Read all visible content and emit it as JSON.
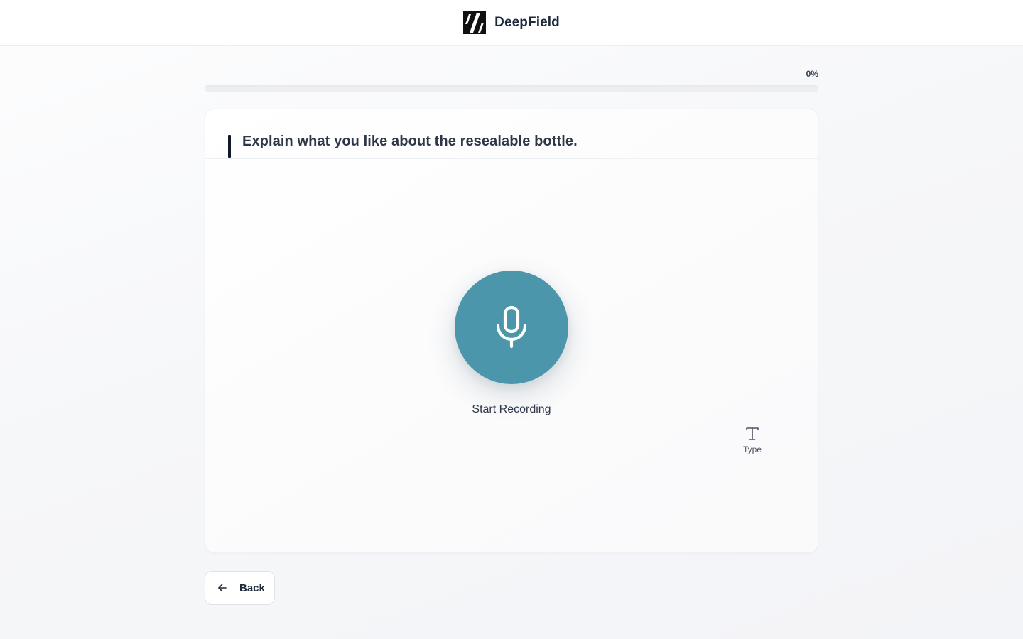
{
  "header": {
    "brand_name": "DeepField",
    "logo_icon": "deepfield-logo-icon"
  },
  "progress": {
    "percent_label": "0%",
    "value": 0
  },
  "question": {
    "text": "Explain what you like about the resealable bottle."
  },
  "recorder": {
    "icon": "microphone-icon",
    "start_label": "Start Recording",
    "accent_color": "#4b96ab"
  },
  "type_toggle": {
    "icon": "text-type-icon",
    "label": "Type"
  },
  "footer": {
    "back_icon": "arrow-left-icon",
    "back_label": "Back"
  }
}
